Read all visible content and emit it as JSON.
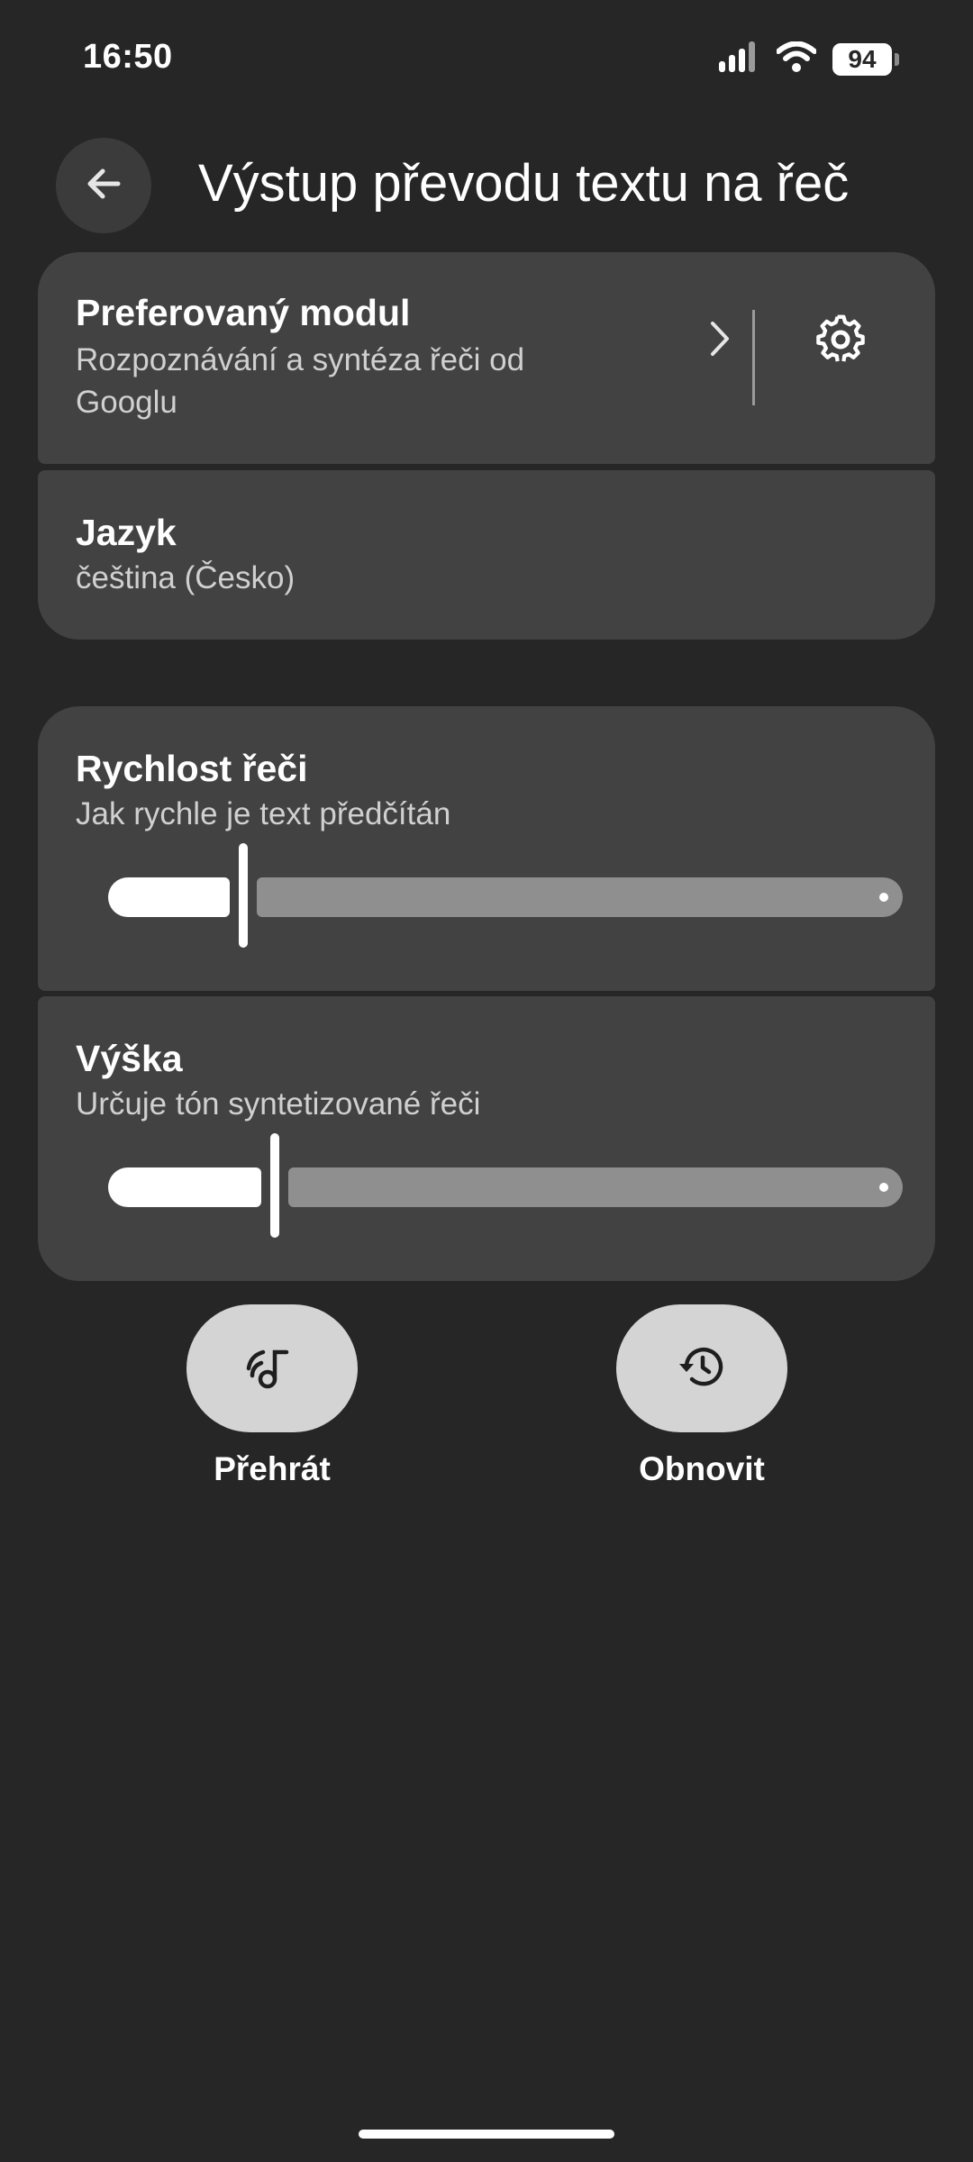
{
  "status_bar": {
    "time": "16:50",
    "battery": "94",
    "icons": [
      "signal-icon",
      "wifi-icon",
      "battery-icon"
    ]
  },
  "header": {
    "back_icon": "back-arrow-icon",
    "title": "Výstup převodu textu na řeč"
  },
  "engine": {
    "title": "Preferovaný modul",
    "subtitle_line1": "Rozpoznávání a syntéza řeči od",
    "subtitle_line2": "Googlu",
    "chevron_icon": "chevron-right-icon",
    "settings_icon": "gear-icon"
  },
  "language": {
    "title": "Jazyk",
    "value": "čeština (Česko)"
  },
  "speech_rate": {
    "title": "Rychlost řeči",
    "subtitle": "Jak rychle je text předčítán",
    "value_fraction": 0.17
  },
  "pitch": {
    "title": "Výška",
    "subtitle": "Určuje tón syntetizované řeči",
    "value_fraction": 0.21
  },
  "actions": {
    "play_label": "Přehrát",
    "play_icon": "speech-music-icon",
    "reset_label": "Obnovit",
    "reset_icon": "history-restore-icon"
  },
  "colors": {
    "background": "#262626",
    "card": "#424242",
    "slider_active": "#ffffff",
    "slider_inactive": "#8f8f8f",
    "action_button": "#d4d4d4"
  }
}
